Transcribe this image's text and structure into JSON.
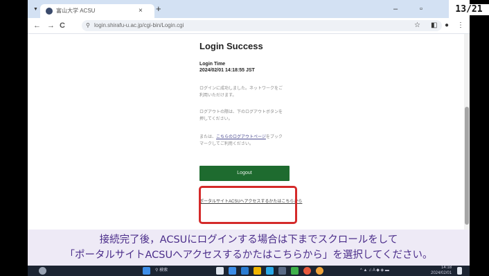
{
  "slide": {
    "page_counter": "13/21"
  },
  "browser": {
    "tab_title": "富山大学 ACSU",
    "tab_close": "×",
    "new_tab": "+",
    "minimize": "–",
    "restore": "▫",
    "close": "×",
    "back": "←",
    "forward": "→",
    "reload": "C",
    "url": "login.shirafu-u.ac.jp/cgi-bin/Login.cgi",
    "star": "☆"
  },
  "page": {
    "heading": "Login Success",
    "login_time_label": "Login Time",
    "login_time": "2024/02/01 14:18:55 JST",
    "para1": "ログインに成功しました。ネットワークをご利用いただけます。",
    "para2": "ログアウトの際は、下のログアウトボタンを押してください。",
    "para3_prefix": "または、",
    "para3_link": "こちらのログアウトページ",
    "para3_suffix": "をブックマークしてご利用ください。",
    "logout_button": "Logout",
    "portal_link": "ポータルサイトACSUへアクセスするかたはこちらから"
  },
  "caption": {
    "line1": "接続完了後，ACSUにログインする場合は下までスクロールをして",
    "line2": "「ポータルサイトACSUへアクセスするかたはこちらから」を選択してください。"
  },
  "taskbar": {
    "search": "検索",
    "clock_time": "14:18",
    "clock_date": "2024/02/01"
  }
}
